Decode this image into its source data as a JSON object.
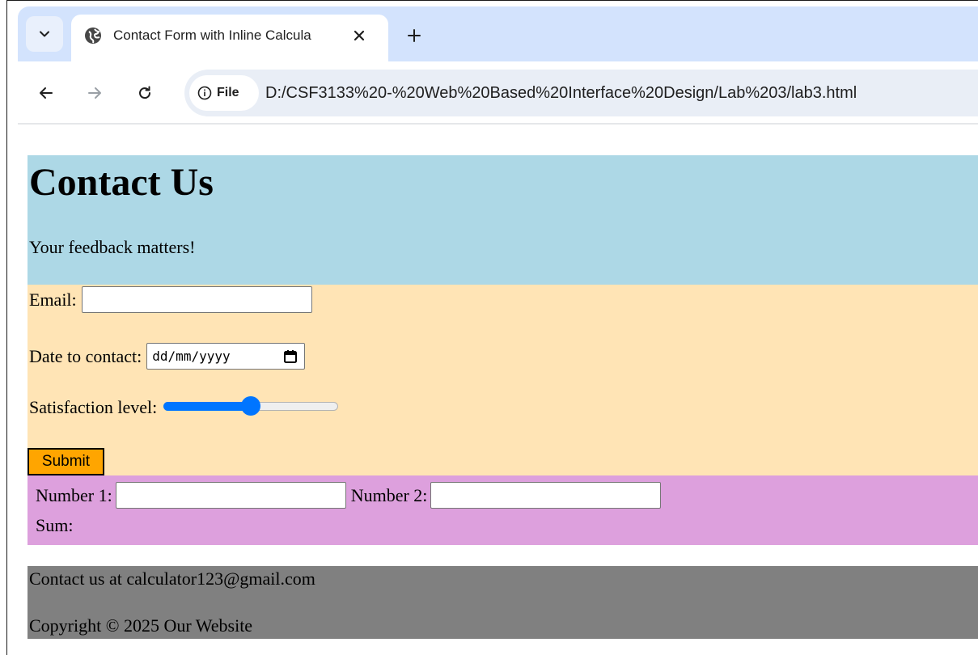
{
  "browser": {
    "tab_title": "Contact Form with Inline Calcula",
    "url_scheme_label": "File",
    "url": "D:/CSF3133%20-%20Web%20Based%20Interface%20Design/Lab%203/lab3.html"
  },
  "header": {
    "title": "Contact Us",
    "subtitle": "Your feedback matters!"
  },
  "form": {
    "email_label": "Email:",
    "email_value": "",
    "date_label": "Date to contact:",
    "date_placeholder": "dd/mm/yyyy",
    "satisfaction_label": "Satisfaction level:",
    "satisfaction_value": 50,
    "submit_label": "Submit"
  },
  "calculator": {
    "number1_label": "Number 1:",
    "number1_value": "",
    "number2_label": "Number 2:",
    "number2_value": "",
    "sum_label": "Sum:"
  },
  "footer": {
    "contact_text": "Contact us at calculator123@gmail.com",
    "copyright_text": "Copyright © 2025 Our Website"
  },
  "colors": {
    "header_bg": "#add8e6",
    "form_bg": "#ffe4b5",
    "calc_bg": "#dda0dd",
    "footer_bg": "#808080",
    "submit_bg": "#ffa500",
    "slider_accent": "#0075ff"
  }
}
